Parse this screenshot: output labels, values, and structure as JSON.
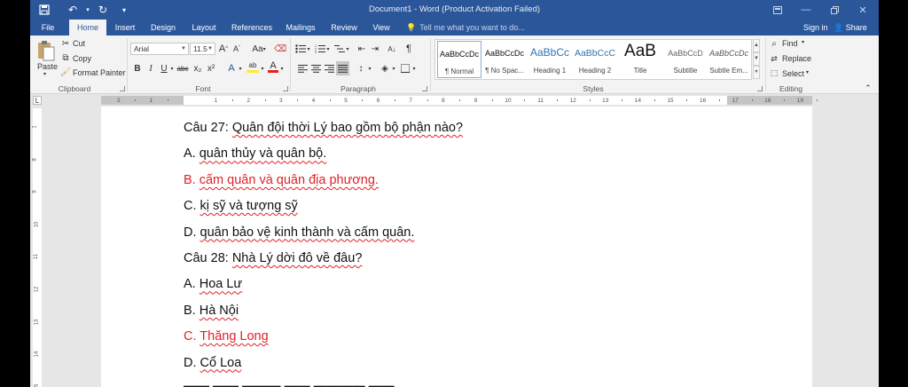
{
  "window": {
    "title": "Document1 - Word (Product Activation Failed)"
  },
  "tabs": [
    {
      "label": "File",
      "active": false
    },
    {
      "label": "Home",
      "active": true
    },
    {
      "label": "Insert",
      "active": false
    },
    {
      "label": "Design",
      "active": false
    },
    {
      "label": "Layout",
      "active": false
    },
    {
      "label": "References",
      "active": false
    },
    {
      "label": "Mailings",
      "active": false
    },
    {
      "label": "Review",
      "active": false
    },
    {
      "label": "View",
      "active": false
    }
  ],
  "tell_me": {
    "placeholder": "Tell me what you want to do..."
  },
  "account": {
    "sign_in": "Sign in",
    "share": "Share"
  },
  "clipboard": {
    "label": "Clipboard",
    "paste": "Paste",
    "cut": "Cut",
    "copy": "Copy",
    "format_painter": "Format Painter"
  },
  "font": {
    "label": "Font",
    "family": "Arial",
    "size": "11.5",
    "bold": "B",
    "italic": "I",
    "underline": "U",
    "strike": "abc",
    "sub": "x₂",
    "sup": "x²",
    "grow": "A",
    "shrink": "A",
    "case": "Aa",
    "effects": "A",
    "highlight": "ab",
    "color": "A"
  },
  "paragraph": {
    "label": "Paragraph",
    "pilcrow": "¶"
  },
  "styles": {
    "label": "Styles",
    "items": [
      {
        "preview": "AaBbCcDc",
        "name": "¶ Normal"
      },
      {
        "preview": "AaBbCcDc",
        "name": "¶ No Spac..."
      },
      {
        "preview": "AaBbCc",
        "name": "Heading 1"
      },
      {
        "preview": "AaBbCcC",
        "name": "Heading 2"
      },
      {
        "preview": "AaB",
        "name": "Title"
      },
      {
        "preview": "AaBbCcD",
        "name": "Subtitle"
      },
      {
        "preview": "AaBbCcDc",
        "name": "Subtle Em..."
      }
    ]
  },
  "editing": {
    "label": "Editing",
    "find": "Find",
    "replace": "Replace",
    "select": "Select"
  },
  "ruler": {
    "ticks": [
      "2",
      "1",
      "1",
      "2",
      "3",
      "4",
      "5",
      "6",
      "7",
      "8",
      "9",
      "10",
      "11",
      "12",
      "13",
      "14",
      "15",
      "16",
      "17",
      "18",
      "19"
    ]
  },
  "vruler": {
    "ticks": [
      "1",
      "8",
      "9",
      "10",
      "11",
      "12",
      "13",
      "14",
      "15"
    ]
  },
  "document": {
    "lines": [
      {
        "prefix": "Câu 27: ",
        "text": "Quân đội thời Lý bao gồm bộ phận nào?",
        "red": false
      },
      {
        "prefix": "A. ",
        "text": "quân thủy và quân bộ.",
        "red": false
      },
      {
        "prefix": "B. ",
        "text": "cấm quân và quân địa phương.",
        "red": true
      },
      {
        "prefix": "C. ",
        "text": "kị sỹ và tượng sỹ",
        "red": false
      },
      {
        "prefix": "D. ",
        "text": "quân bảo vệ kinh thành và cấm quân.",
        "red": false
      },
      {
        "prefix": "Câu 28: ",
        "text": "Nhà Lý dời đô về đâu?",
        "red": false
      },
      {
        "prefix": "A. ",
        "text": "Hoa Lư",
        "red": false
      },
      {
        "prefix": "B. ",
        "text": "Hà Nội",
        "red": false
      },
      {
        "prefix": "C. ",
        "text": "Thăng Long",
        "red": true
      },
      {
        "prefix": "D. ",
        "text": "Cổ Loa",
        "red": false
      }
    ]
  }
}
